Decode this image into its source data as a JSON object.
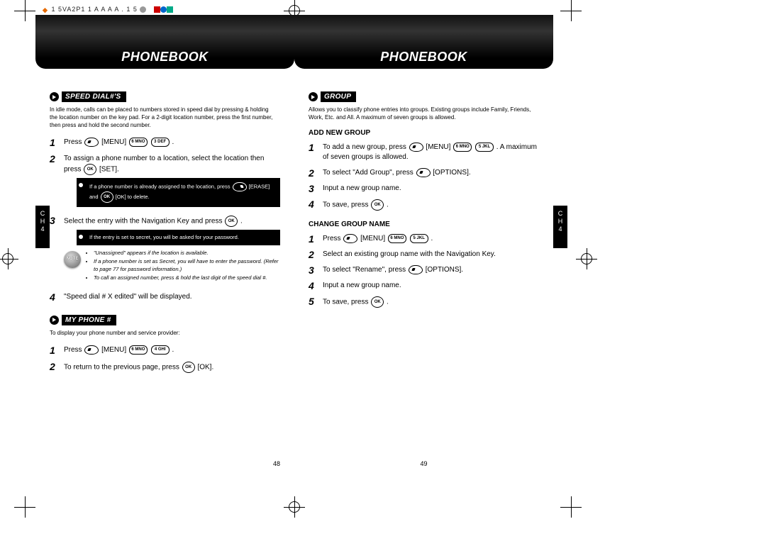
{
  "meta": {
    "line": "1 5VA2P1   1    A            A    A   A .   1              5"
  },
  "header": {
    "title": "PHONEBOOK"
  },
  "side_tab": {
    "line1": "C",
    "line2": "H",
    "line3": "4"
  },
  "left": {
    "section1": {
      "tag": "SPEED DIAL#'S",
      "intro": "In idle mode, calls can be placed to numbers stored in speed dial by pressing & holding the location number on the key pad. For a 2-digit location number, press the first number, then press and hold the second number.",
      "steps": {
        "s1a": "Press ",
        "s1b": " [MENU] ",
        "s1c": " .",
        "s2": "To assign a phone number to a location, select the location then press ",
        "s2b": " [SET].",
        "tip1a": "If a phone number is already assigned to the location, press ",
        "tip1b": " [ERASE] and ",
        "tip1c": " [OK] to delete.",
        "s3a": "Select the entry with the Navigation Key and press ",
        "s3b": " .",
        "tip2": "If the entry is set to secret, you will be asked for your password.",
        "note1": "\"Unassigned\" appears if the location is available.",
        "note2": "If a phone number is set as Secret, you will have to enter the password. (Refer to page 77 for password information.)",
        "note3": "To call an assigned number, press & hold the last digit of the speed dial #.",
        "s4": "\"Speed dial # X edited\" will be displayed."
      }
    },
    "section2": {
      "tag": "MY PHONE #",
      "intro": "To display your phone number and service provider:",
      "steps": {
        "s1a": "Press ",
        "s1b": " [MENU] ",
        "s1c": " .",
        "s2a": "To return to the previous page, press ",
        "s2b": " [OK]."
      }
    },
    "page_num": "48"
  },
  "right": {
    "section1": {
      "tag": "GROUP",
      "intro": "Allows you to classify phone entries into groups. Existing groups include Family, Friends, Work, Etc. and All. A maximum of seven groups is allowed.",
      "add": {
        "heading": "ADD NEW GROUP",
        "s1a": "To add a new group, press ",
        "s1b": " [MENU] ",
        "s1c": " . A maximum of seven groups is allowed.",
        "s2a": "To select \"Add Group\", press ",
        "s2b": " [OPTIONS].",
        "s3": "Input a new group name.",
        "s4a": "To save, press ",
        "s4b": " ."
      },
      "change": {
        "heading": "CHANGE GROUP NAME",
        "s1a": "Press ",
        "s1b": " [MENU] ",
        "s1c": " .",
        "s2": "Select an existing group name with the Navigation Key.",
        "s3a": "To select \"Rename\", press ",
        "s3b": " [OPTIONS].",
        "s4": "Input a new group name.",
        "s5a": "To save, press ",
        "s5b": " ."
      }
    },
    "page_num": "49"
  },
  "keys": {
    "six": "6 MNO",
    "three": "3 DEF",
    "four": "4 GHI",
    "five": "5 JKL",
    "ok": "OK"
  }
}
